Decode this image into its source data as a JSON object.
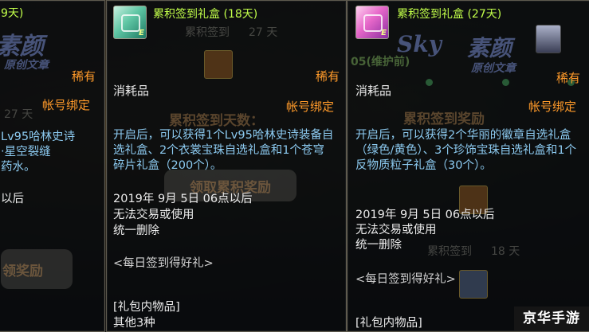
{
  "left_panel": {
    "title_fragment": "9天)",
    "watermark": "素颜",
    "watermark_sub": "原创文章",
    "rarity": "稀有",
    "binding": "帐号绑定",
    "bg_number": "27 天",
    "desc_lines": [
      "Lv95哈林史诗",
      "‧星空裂缝",
      "药水。"
    ],
    "date_fragment": "以后",
    "bg_button": "领奖励"
  },
  "middle_panel": {
    "item_title": "累积签到礼盒 (18天)",
    "bg_label": "累积签到",
    "bg_days": "27 天",
    "bg_heading": "累积签到天数：",
    "bg_button": "领取累积奖励",
    "rarity": "稀有",
    "category": "消耗品",
    "binding": "帐号绑定",
    "description": "开启后，可以获得1个Lv95哈林史诗装备自选礼盒、2个衣裳宝珠自选礼盒和1个苍穹碎片礼盒（200个）。",
    "expiry_lines": [
      "2019年 9月 5日 06点以后",
      "无法交易或使用",
      "统一删除"
    ],
    "source": "<每日签到得好礼>",
    "contents_header": "[礼包内物品]",
    "contents_first": "其他3种"
  },
  "right_panel": {
    "item_title": "累积签到礼盒 (27天)",
    "watermark": "Sky",
    "watermark_logo": "素颜",
    "watermark_sub": "原创文章",
    "bg_fragment": "05(维护前)",
    "bg_heading": "累积签到奖励",
    "bg_label": "累积签到",
    "bg_days": "18 天",
    "rarity": "稀有",
    "category": "消耗品",
    "binding": "帐号绑定",
    "description": "开启后，可以获得2个华丽的徽章自选礼盒（绿色/黄色）、3个珍饰宝珠自选礼盒和1个反物质粒子礼盒（30个）。",
    "expiry_lines": [
      "2019年 9月 5日 06点以后",
      "无法交易或使用",
      "统一删除"
    ],
    "source": "<每日签到得好礼>",
    "contents_header": "[礼包内物品]"
  },
  "badge": "京华手游",
  "colors": {
    "title": "#c2ff4a",
    "rarity": "#ff9a2a",
    "description": "#8ccaf0"
  }
}
